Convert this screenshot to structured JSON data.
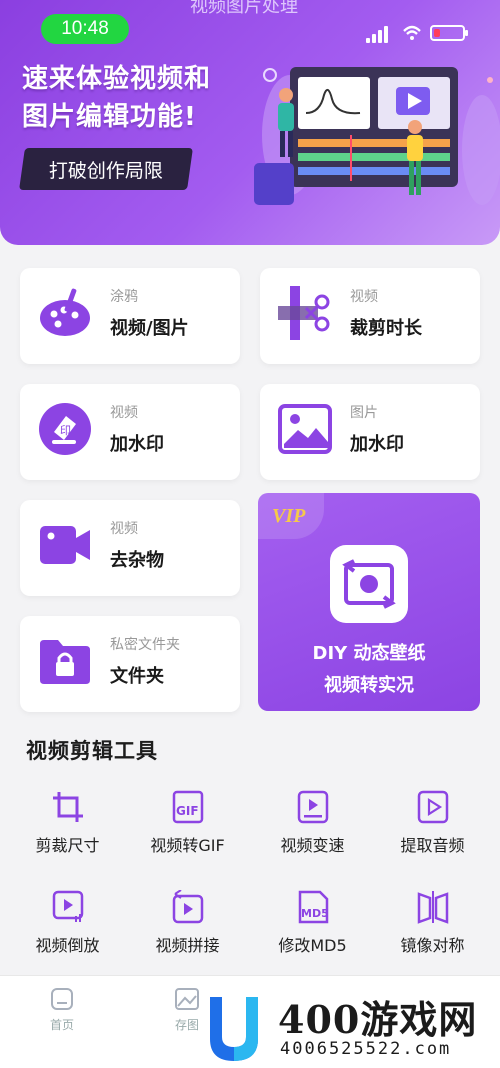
{
  "status_bar": {
    "time": "10:48",
    "top_title": "视频图片处理"
  },
  "banner": {
    "headline_line1": "速来体验视频和",
    "headline_line2": "图片编辑功能!",
    "cta_label": "打破创作局限"
  },
  "cards": [
    {
      "sub": "涂鸦",
      "main": "视频/图片",
      "icon": "palette-icon"
    },
    {
      "sub": "视频",
      "main": "裁剪时长",
      "icon": "scissors-icon"
    },
    {
      "sub": "视频",
      "main": "加水印",
      "icon": "stamp-icon"
    },
    {
      "sub": "图片",
      "main": "加水印",
      "icon": "image-icon"
    },
    {
      "sub": "视频",
      "main": "去杂物",
      "icon": "video-camera-icon"
    },
    {
      "sub": "私密文件夹",
      "main": "文件夹",
      "icon": "lock-folder-icon"
    }
  ],
  "vip_card": {
    "badge": "VIP",
    "line1": "DIY 动态壁纸",
    "line2": "视频转实况",
    "icon": "refresh-frame-icon"
  },
  "tools_section": {
    "title": "视频剪辑工具",
    "items": [
      {
        "label": "剪裁尺寸",
        "icon": "crop-icon"
      },
      {
        "label": "视频转GIF",
        "icon": "gif-icon"
      },
      {
        "label": "视频变速",
        "icon": "speed-icon"
      },
      {
        "label": "提取音频",
        "icon": "audio-extract-icon"
      },
      {
        "label": "视频倒放",
        "icon": "reverse-play-icon"
      },
      {
        "label": "视频拼接",
        "icon": "merge-icon"
      },
      {
        "label": "修改MD5",
        "icon": "md5-icon"
      },
      {
        "label": "镜像对称",
        "icon": "mirror-icon"
      }
    ]
  },
  "bottom_nav": [
    {
      "label": "首页",
      "icon": "home-icon"
    },
    {
      "label": "存图",
      "icon": "gallery-icon"
    }
  ],
  "watermark": {
    "text": "400游戏网",
    "url": "4006525522.com"
  },
  "colors": {
    "accent": "#8c44e3",
    "time_pill": "#22d641",
    "vip_gold": "#f5c94a"
  }
}
